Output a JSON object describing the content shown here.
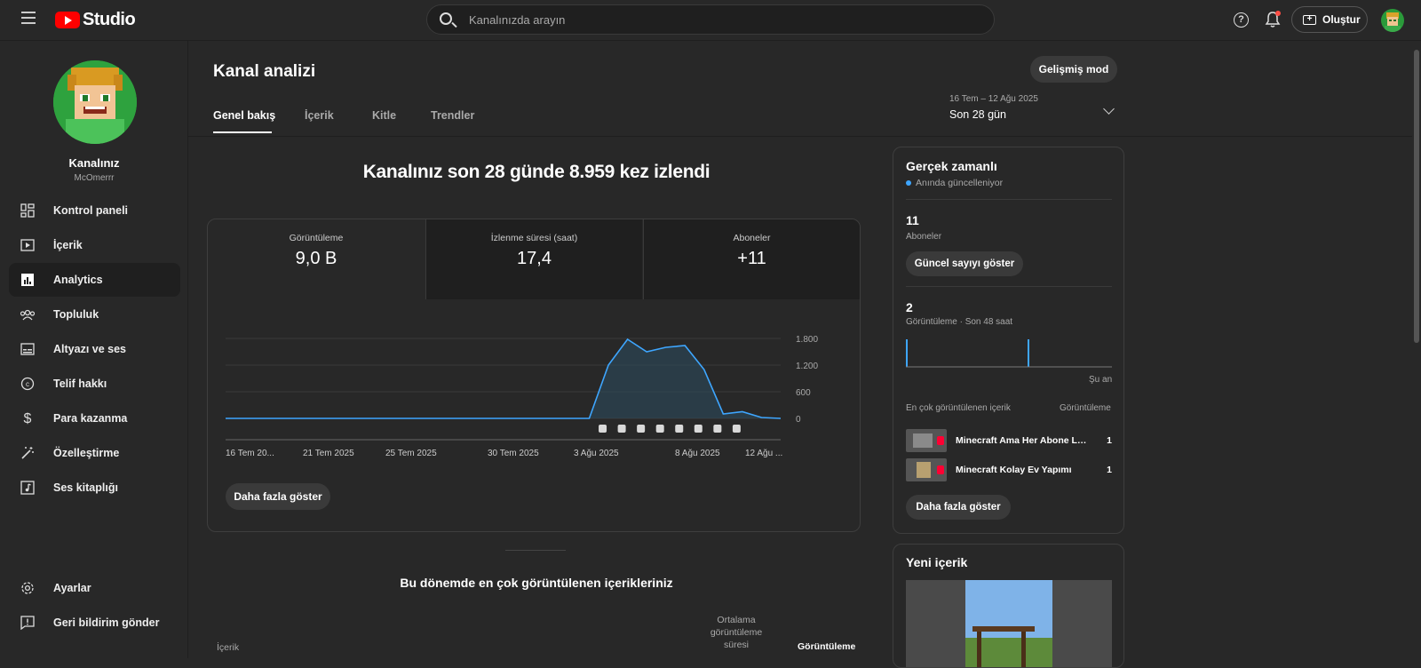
{
  "topbar": {
    "logo_text": "Studio",
    "search_placeholder": "Kanalınızda arayın",
    "help_symbol": "?",
    "create_label": "Oluştur"
  },
  "sidebar": {
    "channel_name": "Kanalınız",
    "channel_handle": "McOmerrr",
    "items": [
      {
        "label": "Kontrol paneli",
        "icon": "dashboard-icon"
      },
      {
        "label": "İçerik",
        "icon": "content-icon"
      },
      {
        "label": "Analytics",
        "icon": "analytics-icon",
        "active": true
      },
      {
        "label": "Topluluk",
        "icon": "community-icon"
      },
      {
        "label": "Altyazı ve ses",
        "icon": "subtitles-icon"
      },
      {
        "label": "Telif hakkı",
        "icon": "copyright-icon"
      },
      {
        "label": "Para kazanma",
        "icon": "dollar-icon"
      },
      {
        "label": "Özelleştirme",
        "icon": "magic-wand-icon"
      },
      {
        "label": "Ses kitaplığı",
        "icon": "audio-library-icon"
      }
    ],
    "footer": [
      {
        "label": "Ayarlar",
        "icon": "gear-icon"
      },
      {
        "label": "Geri bildirim gönder",
        "icon": "feedback-icon"
      }
    ]
  },
  "page": {
    "title": "Kanal analizi",
    "advanced_mode": "Gelişmiş mod",
    "tabs": [
      "Genel bakış",
      "İçerik",
      "Kitle",
      "Trendler"
    ],
    "date_range": "16 Tem – 12 Ağu 2025",
    "date_label": "Son 28 gün",
    "headline": "Kanalınız son 28 günde 8.959 kez izlendi"
  },
  "metrics": [
    {
      "label": "Görüntüleme",
      "value": "9,0 B"
    },
    {
      "label": "İzlenme süresi (saat)",
      "value": "17,4"
    },
    {
      "label": "Aboneler",
      "value": "+11"
    }
  ],
  "chart_data": {
    "type": "area",
    "x_tick_labels": [
      "16 Tem 20...",
      "21 Tem 2025",
      "25 Tem 2025",
      "30 Tem 2025",
      "3 Ağu 2025",
      "8 Ağu 2025",
      "12 Ağu ..."
    ],
    "y_ticks": [
      "0",
      "600",
      "1.200",
      "1.800"
    ],
    "ylim": [
      0,
      1800
    ],
    "series": [
      {
        "values": [
          0,
          0,
          0,
          0,
          0,
          0,
          0,
          0,
          0,
          0,
          0,
          0,
          0,
          0,
          0,
          0,
          0,
          0,
          0,
          0,
          1200,
          1780,
          1500,
          1600,
          1640,
          1100,
          100,
          150,
          20,
          0
        ]
      }
    ],
    "grid": true
  },
  "card": {
    "more_button": "Daha fazla göster"
  },
  "top_content": {
    "title": "Bu dönemde en çok görüntülenen içerikleriniz",
    "col_content": "İçerik",
    "col_avg": "Ortalama görüntüleme süresi",
    "col_views": "Görüntüleme"
  },
  "realtime": {
    "title": "Gerçek zamanlı",
    "subtitle": "Anında güncelleniyor",
    "subs_value": "11",
    "subs_label": "Aboneler",
    "show_count_btn": "Güncel sayıyı göster",
    "views_value": "2",
    "views_label": "Görüntüleme · Son 48 saat",
    "now_label": "Şu an",
    "top_label": "En çok görüntülenen içerik",
    "views_col": "Görüntüleme",
    "rows": [
      {
        "title": "Minecraft Ama Her Abone Lik...",
        "views": "1"
      },
      {
        "title": "Minecraft Kolay Ev Yapımı",
        "views": "1"
      }
    ],
    "more_btn": "Daha fazla göster"
  },
  "new_content": {
    "title": "Yeni içerik"
  },
  "colors": {
    "accent_blue": "#3ea6ff",
    "brand_red": "#ff0000"
  }
}
